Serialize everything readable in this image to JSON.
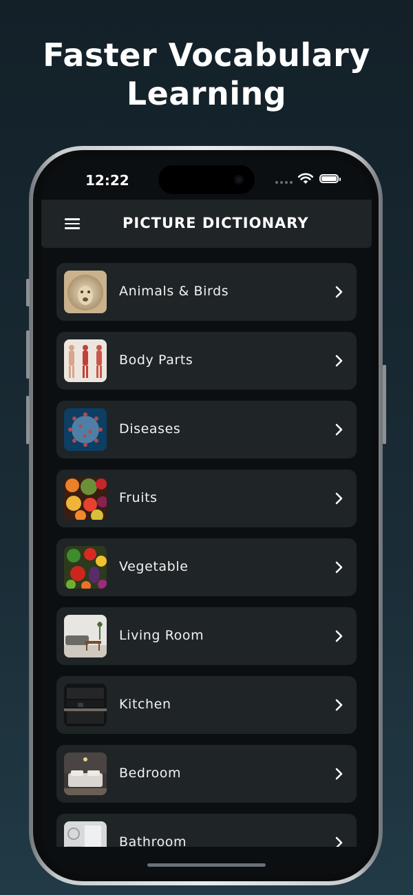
{
  "promo": {
    "headline_line1": "Faster Vocabulary",
    "headline_line2": "Learning"
  },
  "status_bar": {
    "time": "12:22"
  },
  "app_bar": {
    "title": "PICTURE DICTIONARY",
    "menu_icon": "hamburger-menu-icon"
  },
  "categories": [
    {
      "label": "Animals & Birds",
      "thumbnail": "lion-photo"
    },
    {
      "label": "Body Parts",
      "thumbnail": "anatomy-photo"
    },
    {
      "label": "Diseases",
      "thumbnail": "virus-photo"
    },
    {
      "label": "Fruits",
      "thumbnail": "fruits-photo"
    },
    {
      "label": "Vegetable",
      "thumbnail": "vegetables-photo"
    },
    {
      "label": "Living Room",
      "thumbnail": "living-room-photo"
    },
    {
      "label": "Kitchen",
      "thumbnail": "kitchen-photo"
    },
    {
      "label": "Bedroom",
      "thumbnail": "bedroom-photo"
    },
    {
      "label": "Bathroom",
      "thumbnail": "bathroom-photo"
    }
  ],
  "colors": {
    "row_background": "#1f2427",
    "screen_background": "#0b0f12",
    "text": "#ffffff"
  }
}
